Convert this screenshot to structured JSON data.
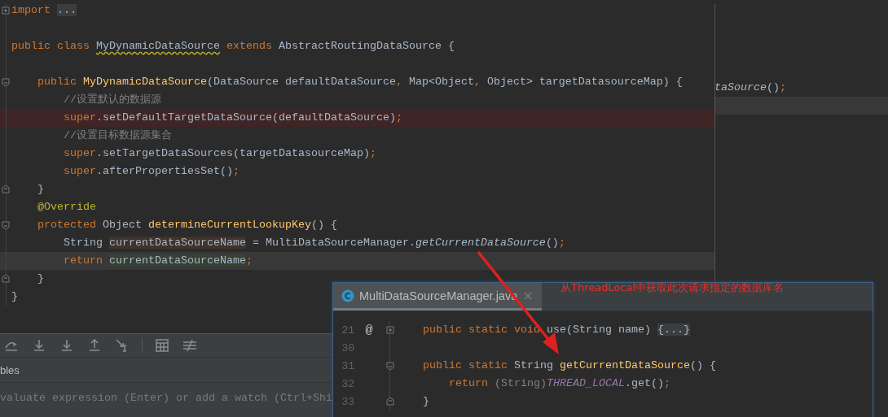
{
  "background_editor": {
    "lines": [
      {
        "kind": "code",
        "current": false,
        "tokens": [
          {
            "kind": "italic",
            "text": "taSource"
          },
          {
            "kind": "plain",
            "text": "()"
          },
          {
            "kind": "punct",
            "text": ";"
          }
        ]
      },
      {
        "kind": "blank",
        "current": true
      }
    ]
  },
  "front_editor": {
    "lines": [
      {
        "kind": "folded",
        "breakpoint": false,
        "current": false,
        "tokens": [
          {
            "kind": "keyword",
            "text": "import "
          },
          {
            "kind": "folded",
            "text": "..."
          }
        ]
      },
      {
        "kind": "blank",
        "breakpoint": false,
        "current": false
      },
      {
        "kind": "code",
        "breakpoint": false,
        "current": false,
        "tokens": [
          {
            "kind": "keyword",
            "text": "public class "
          },
          {
            "kind": "warned",
            "text": "MyDynamicDataSource"
          },
          {
            "kind": "keyword",
            "text": " extends "
          },
          {
            "kind": "plain",
            "text": "AbstractRoutingDataSource {"
          }
        ]
      },
      {
        "kind": "blank",
        "breakpoint": false,
        "current": false
      },
      {
        "kind": "fold-start",
        "breakpoint": false,
        "current": false,
        "tokens": [
          {
            "kind": "keyword",
            "text": "    public "
          },
          {
            "kind": "decl",
            "text": "MyDynamicDataSource"
          },
          {
            "kind": "plain",
            "text": "(DataSource defaultDataSource"
          },
          {
            "kind": "punct",
            "text": ", "
          },
          {
            "kind": "plain",
            "text": "Map<Object"
          },
          {
            "kind": "punct",
            "text": ", "
          },
          {
            "kind": "plain",
            "text": "Object> targetDatasourceMap) {"
          }
        ]
      },
      {
        "kind": "code",
        "breakpoint": false,
        "current": false,
        "tokens": [
          {
            "kind": "comment",
            "text": "        //设置默认的数据源"
          }
        ]
      },
      {
        "kind": "code",
        "breakpoint": true,
        "current": false,
        "tokens": [
          {
            "kind": "keyword",
            "text": "        super"
          },
          {
            "kind": "plain",
            "text": ".setDefaultTargetDataSource(defaultDataSource)"
          },
          {
            "kind": "punct",
            "text": ";"
          }
        ]
      },
      {
        "kind": "code",
        "breakpoint": false,
        "current": false,
        "tokens": [
          {
            "kind": "comment",
            "text": "        //设置目标数据源集合"
          }
        ]
      },
      {
        "kind": "code",
        "breakpoint": false,
        "current": false,
        "tokens": [
          {
            "kind": "keyword",
            "text": "        super"
          },
          {
            "kind": "plain",
            "text": ".setTargetDataSources(targetDatasourceMap)"
          },
          {
            "kind": "punct",
            "text": ";"
          }
        ]
      },
      {
        "kind": "code",
        "breakpoint": false,
        "current": false,
        "tokens": [
          {
            "kind": "keyword",
            "text": "        super"
          },
          {
            "kind": "plain",
            "text": ".afterPropertiesSet()"
          },
          {
            "kind": "punct",
            "text": ";"
          }
        ]
      },
      {
        "kind": "fold-end",
        "breakpoint": false,
        "current": false,
        "tokens": [
          {
            "kind": "plain",
            "text": "    }"
          }
        ]
      },
      {
        "kind": "code",
        "breakpoint": false,
        "current": false,
        "tokens": [
          {
            "kind": "annotation",
            "text": "    @Override"
          }
        ]
      },
      {
        "kind": "fold-start",
        "breakpoint": false,
        "current": false,
        "tokens": [
          {
            "kind": "keyword",
            "text": "    protected "
          },
          {
            "kind": "plain",
            "text": "Object "
          },
          {
            "kind": "decl",
            "text": "determineCurrentLookupKey"
          },
          {
            "kind": "plain",
            "text": "() {"
          }
        ]
      },
      {
        "kind": "code",
        "breakpoint": false,
        "current": false,
        "tokens": [
          {
            "kind": "plain",
            "text": "        String "
          },
          {
            "kind": "written",
            "text": "currentDataSourceName"
          },
          {
            "kind": "plain",
            "text": " = MultiDataSourceManager."
          },
          {
            "kind": "italic",
            "text": "getCurrentDataSource"
          },
          {
            "kind": "plain",
            "text": "()"
          },
          {
            "kind": "punct",
            "text": ";"
          }
        ]
      },
      {
        "kind": "code",
        "breakpoint": false,
        "current": true,
        "tokens": [
          {
            "kind": "keyword",
            "text": "        return "
          },
          {
            "kind": "read",
            "text": "currentDataSourceName"
          },
          {
            "kind": "punct",
            "text": ";"
          }
        ]
      },
      {
        "kind": "fold-end",
        "breakpoint": false,
        "current": false,
        "tokens": [
          {
            "kind": "plain",
            "text": "    }"
          }
        ]
      },
      {
        "kind": "code",
        "breakpoint": false,
        "current": false,
        "tokens": [
          {
            "kind": "plain",
            "text": "}"
          }
        ]
      }
    ]
  },
  "debug_panel": {
    "tab": "bles",
    "watch_field": {
      "placeholder": "valuate expression (Enter) or add a watch (Ctrl+Shi"
    }
  },
  "popup": {
    "tabs": [
      {
        "label": "MultiDataSourceManager.java",
        "selected": true
      }
    ],
    "lines": [
      {
        "number": "21",
        "marker": "@",
        "kind": "folded",
        "tokens": [
          {
            "kind": "keyword",
            "text": "    public static void "
          },
          {
            "kind": "plain",
            "text": "use(String name) "
          },
          {
            "kind": "folded",
            "text": "{...}"
          }
        ]
      },
      {
        "number": "30",
        "kind": "blank"
      },
      {
        "number": "31",
        "kind": "fold-start",
        "tokens": [
          {
            "kind": "keyword",
            "text": "    public static "
          },
          {
            "kind": "plain",
            "text": "String "
          },
          {
            "kind": "decl",
            "text": "getCurrentDataSource"
          },
          {
            "kind": "plain",
            "text": "() {"
          }
        ]
      },
      {
        "number": "32",
        "kind": "code",
        "tokens": [
          {
            "kind": "keyword",
            "text": "        return "
          },
          {
            "kind": "redundant",
            "text": "(String)"
          },
          {
            "kind": "static",
            "text": "THREAD_LOCAL"
          },
          {
            "kind": "plain",
            "text": ".get()"
          },
          {
            "kind": "punct",
            "text": ";"
          }
        ]
      },
      {
        "number": "33",
        "kind": "fold-end",
        "tokens": [
          {
            "kind": "plain",
            "text": "    }"
          }
        ]
      }
    ]
  },
  "annotation": {
    "text": "从ThreadLocal中获取此次请求指定的数据库名"
  }
}
